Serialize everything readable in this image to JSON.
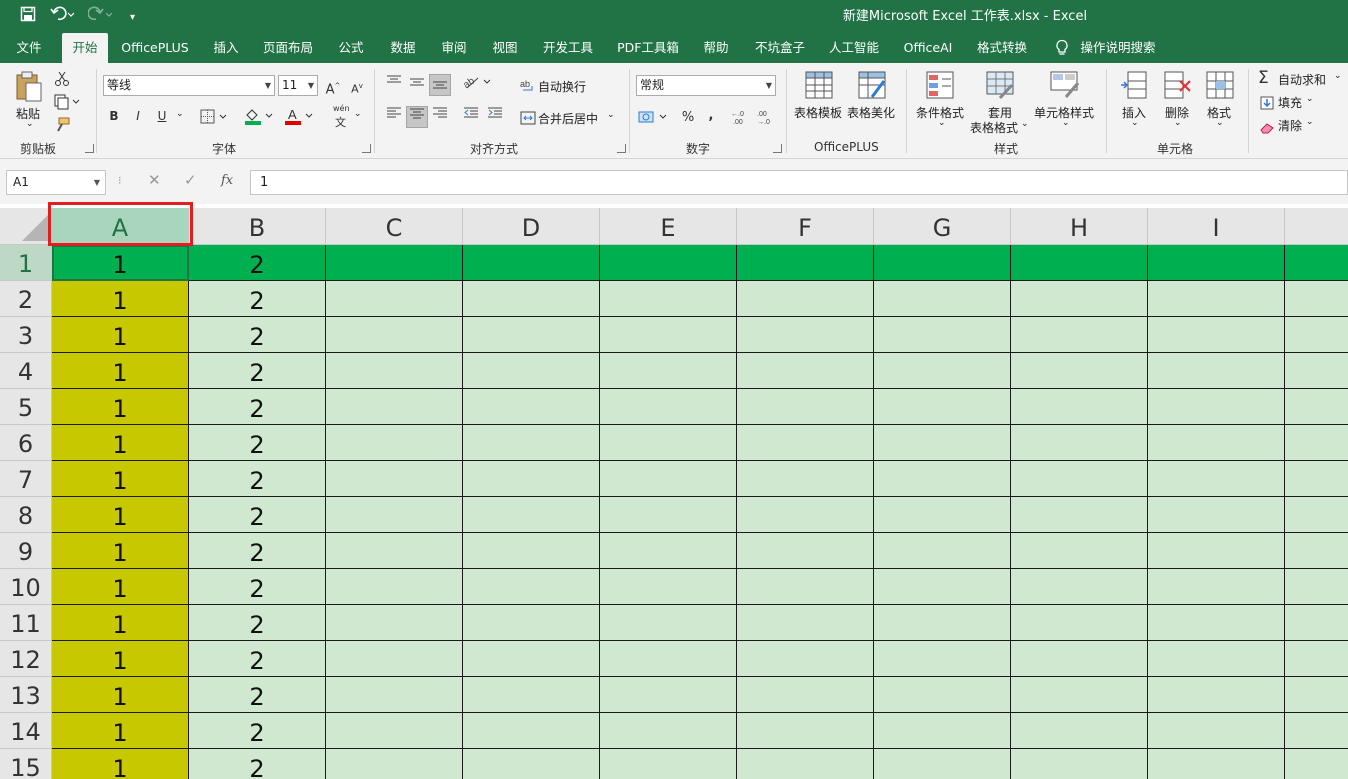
{
  "window": {
    "title": "新建Microsoft Excel 工作表.xlsx  -  Excel"
  },
  "quick_access": {
    "save_icon": "save-icon",
    "undo_icon": "undo-icon",
    "redo_icon": "redo-icon",
    "customize_icon": "customize-qat-icon"
  },
  "tabs": [
    "文件",
    "开始",
    "OfficePLUS",
    "插入",
    "页面布局",
    "公式",
    "数据",
    "审阅",
    "视图",
    "开发工具",
    "PDF工具箱",
    "帮助",
    "不坑盒子",
    "人工智能",
    "OfficeAI",
    "格式转换",
    "操作说明搜索"
  ],
  "active_tab": "开始",
  "ribbon": {
    "clipboard": {
      "paste": "粘贴",
      "label": "剪贴板"
    },
    "font": {
      "name": "等线",
      "size": "11",
      "bold": "B",
      "italic": "I",
      "underline": "U",
      "label": "字体",
      "increase": "A",
      "decrease": "A",
      "phonetic": "wén",
      "phonetic2": "文"
    },
    "alignment": {
      "wrap": "自动换行",
      "merge": "合并后居中",
      "label": "对齐方式"
    },
    "number": {
      "format": "常规",
      "percent": "%",
      "comma": ",",
      "label": "数字"
    },
    "officeplus": {
      "template": "表格模板",
      "beautify": "表格美化",
      "label": "OfficePLUS"
    },
    "styles": {
      "conditional": "条件格式",
      "table_format_1": "套用",
      "table_format_2": "表格格式",
      "cell_styles": "单元格样式",
      "label": "样式"
    },
    "cells": {
      "insert": "插入",
      "delete": "删除",
      "format": "格式",
      "label": "单元格"
    },
    "editing": {
      "autosum": "自动求和",
      "fill": "填充",
      "clear": "清除"
    }
  },
  "formula_bar": {
    "name_box": "A1",
    "fx": "fx",
    "value": "1"
  },
  "sheet": {
    "columns": [
      "A",
      "B",
      "C",
      "D",
      "E",
      "F",
      "G",
      "H",
      "I"
    ],
    "rows": [
      "1",
      "2",
      "3",
      "4",
      "5",
      "6",
      "7",
      "8",
      "9",
      "10",
      "11",
      "12",
      "13",
      "14",
      "15"
    ],
    "col_a_values": [
      "1",
      "1",
      "1",
      "1",
      "1",
      "1",
      "1",
      "1",
      "1",
      "1",
      "1",
      "1",
      "1",
      "1",
      "1"
    ],
    "col_b_values": [
      "2",
      "2",
      "2",
      "2",
      "2",
      "2",
      "2",
      "2",
      "2",
      "2",
      "2",
      "2",
      "2",
      "2",
      "2"
    ],
    "selected_cell": "A1",
    "colors": {
      "row1_fill": "#00b050",
      "col_a_fill": "#c8c800",
      "sheet_fill": "#cfe8cf",
      "accent": "#217346",
      "highlight_box": "#e02020"
    }
  }
}
